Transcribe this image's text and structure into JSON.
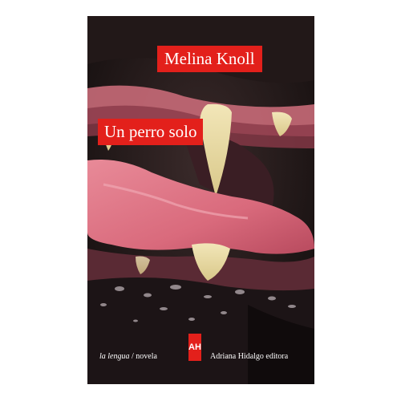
{
  "book": {
    "author": "Melina Knoll",
    "title": "Un perro solo",
    "series": "la lengua",
    "separator": "/",
    "genre": "novela",
    "publisher": "Adriana Hidalgo editora",
    "logo_text": "AH"
  },
  "colors": {
    "label_red": "#e3201b",
    "text_white": "#ffffff",
    "background": "#ffffff"
  }
}
